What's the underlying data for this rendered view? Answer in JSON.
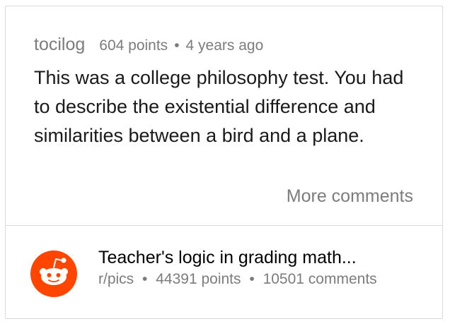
{
  "comment": {
    "author": "tocilog",
    "points": "604 points",
    "separator": "•",
    "age": "4 years ago",
    "body": "This was a college philosophy test. You had to describe the existential difference and similarities between a bird and a plane.",
    "more_label": "More comments"
  },
  "post": {
    "icon": "reddit-alien-icon",
    "icon_color": "#ff4500",
    "title": "Teacher's logic in grading math...",
    "subreddit": "r/pics",
    "separator": "•",
    "points": "44391 points",
    "comments": "10501 comments"
  }
}
